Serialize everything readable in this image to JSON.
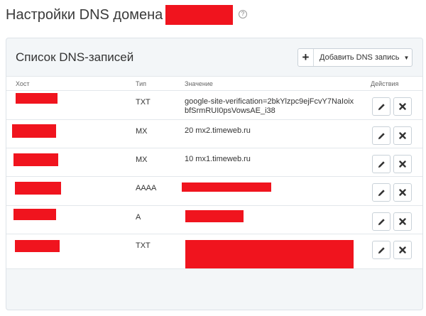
{
  "page": {
    "title": "Настройки DNS домена",
    "help": "?"
  },
  "panel": {
    "title": "Список DNS-записей",
    "add_label": "Добавить DNS запись",
    "add_plus": "+",
    "add_caret": "▼"
  },
  "columns": {
    "host": "Хост",
    "type": "Тип",
    "value": "Значение",
    "actions": "Действия"
  },
  "records": [
    {
      "type": "TXT",
      "value_line1": "google-site-verification=2bkYlzpc9ejFcvY7NaIoix",
      "value_line2": "bfSrmRUI0psVowsAE_i38"
    },
    {
      "type": "MX",
      "value_line1": "20 mx2.timeweb.ru",
      "value_line2": ""
    },
    {
      "type": "MX",
      "value_line1": "10 mx1.timeweb.ru",
      "value_line2": ""
    },
    {
      "type": "AAAA",
      "value_line1": "",
      "value_line2": ""
    },
    {
      "type": "A",
      "value_line1": "",
      "value_line2": ""
    },
    {
      "type": "TXT",
      "value_line1": "",
      "value_line2": ""
    }
  ],
  "colors": {
    "redaction": "#f0141e",
    "panel_bg": "#f3f6f8",
    "border": "#dde3e8"
  },
  "icons": {
    "edit": "pencil-icon",
    "delete": "close-icon",
    "add": "plus-icon",
    "help": "question-circle-icon"
  }
}
